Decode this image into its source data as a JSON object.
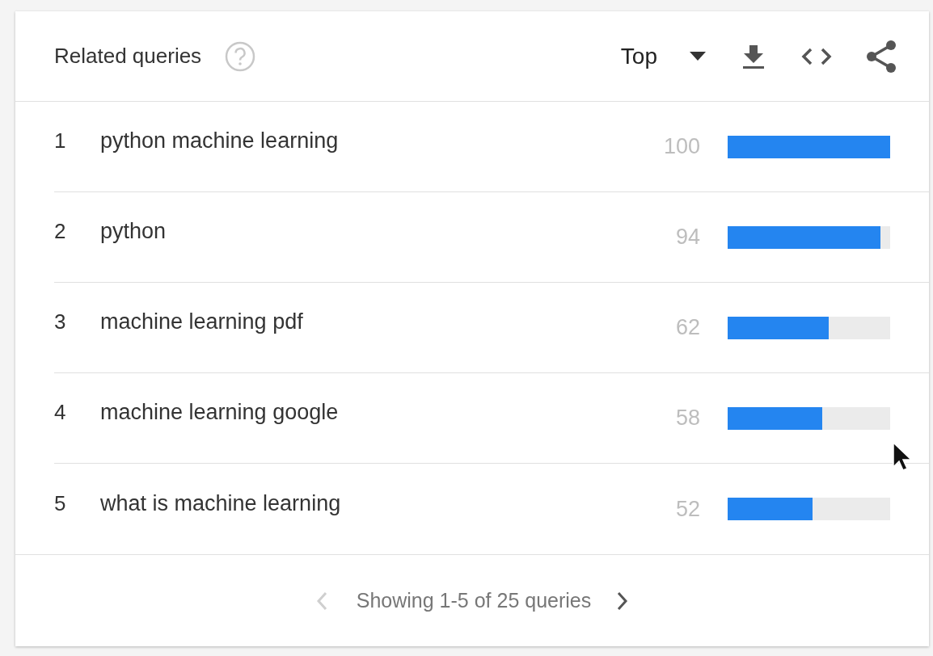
{
  "card": {
    "title": "Related queries",
    "dropdown": {
      "value": "Top"
    }
  },
  "rows": [
    {
      "rank": "1",
      "query": "python machine learning",
      "value": "100",
      "level": 1.0
    },
    {
      "rank": "2",
      "query": "python",
      "value": "94",
      "level": 0.94
    },
    {
      "rank": "3",
      "query": "machine learning pdf",
      "value": "62",
      "level": 0.62
    },
    {
      "rank": "4",
      "query": "machine learning google",
      "value": "58",
      "level": 0.58
    },
    {
      "rank": "5",
      "query": "what is machine learning",
      "value": "52",
      "level": 0.52
    }
  ],
  "pagination": {
    "label": "Showing 1-5 of 25 queries",
    "previous": {
      "disabled": true
    },
    "next": {
      "disabled": false
    }
  }
}
